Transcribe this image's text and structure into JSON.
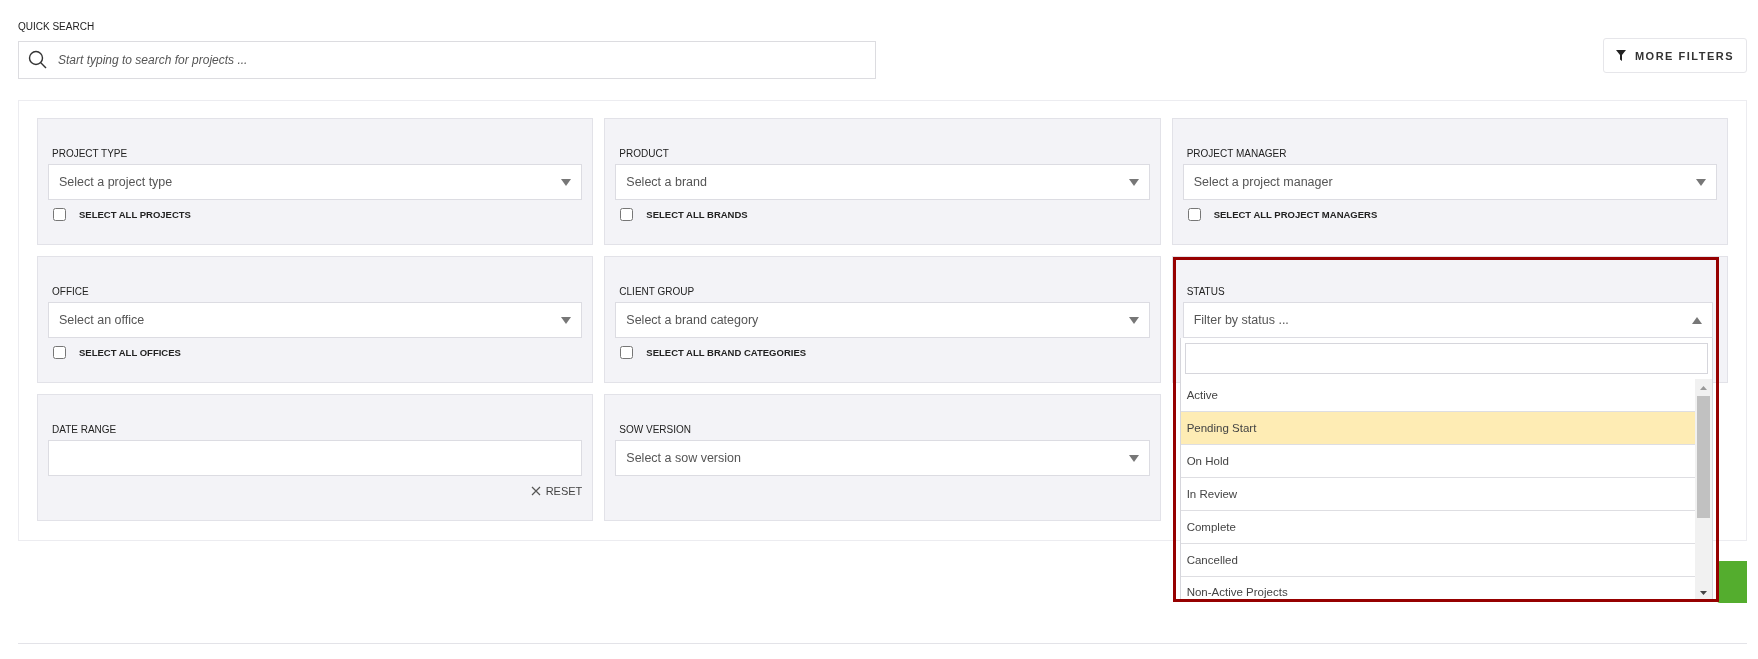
{
  "quick_search": {
    "label": "QUICK SEARCH",
    "placeholder": "Start typing to search for projects ..."
  },
  "more_filters": {
    "label": "MORE FILTERS"
  },
  "filters": [
    {
      "kind": "select",
      "label": "PROJECT TYPE",
      "placeholder": "Select a project type",
      "select_all": {
        "label": "SELECT ALL PROJECTS",
        "checked": false
      }
    },
    {
      "kind": "select",
      "label": "PRODUCT",
      "placeholder": "Select a brand",
      "select_all": {
        "label": "SELECT ALL BRANDS",
        "checked": false
      }
    },
    {
      "kind": "select",
      "label": "PROJECT MANAGER",
      "placeholder": "Select a project manager",
      "select_all": {
        "label": "SELECT ALL PROJECT MANAGERS",
        "checked": false
      }
    },
    {
      "kind": "select",
      "label": "OFFICE",
      "placeholder": "Select an office",
      "select_all": {
        "label": "SELECT ALL OFFICES",
        "checked": false
      }
    },
    {
      "kind": "select",
      "label": "CLIENT GROUP",
      "placeholder": "Select a brand category",
      "select_all": {
        "label": "SELECT ALL BRAND CATEGORIES",
        "checked": false
      }
    },
    {
      "kind": "status",
      "label": "STATUS",
      "placeholder": "Filter by status ...",
      "expanded": true,
      "highlighted": true,
      "options": [
        {
          "label": "Active",
          "selected": false
        },
        {
          "label": "Pending Start",
          "selected": true
        },
        {
          "label": "On Hold",
          "selected": false
        },
        {
          "label": "In Review",
          "selected": false
        },
        {
          "label": "Complete",
          "selected": false
        },
        {
          "label": "Cancelled",
          "selected": false
        },
        {
          "label": "Non-Active Projects",
          "selected": false
        }
      ]
    },
    {
      "kind": "date",
      "label": "DATE RANGE",
      "reset": "RESET"
    },
    {
      "kind": "select",
      "label": "SOW VERSION",
      "placeholder": "Select a sow version"
    }
  ]
}
